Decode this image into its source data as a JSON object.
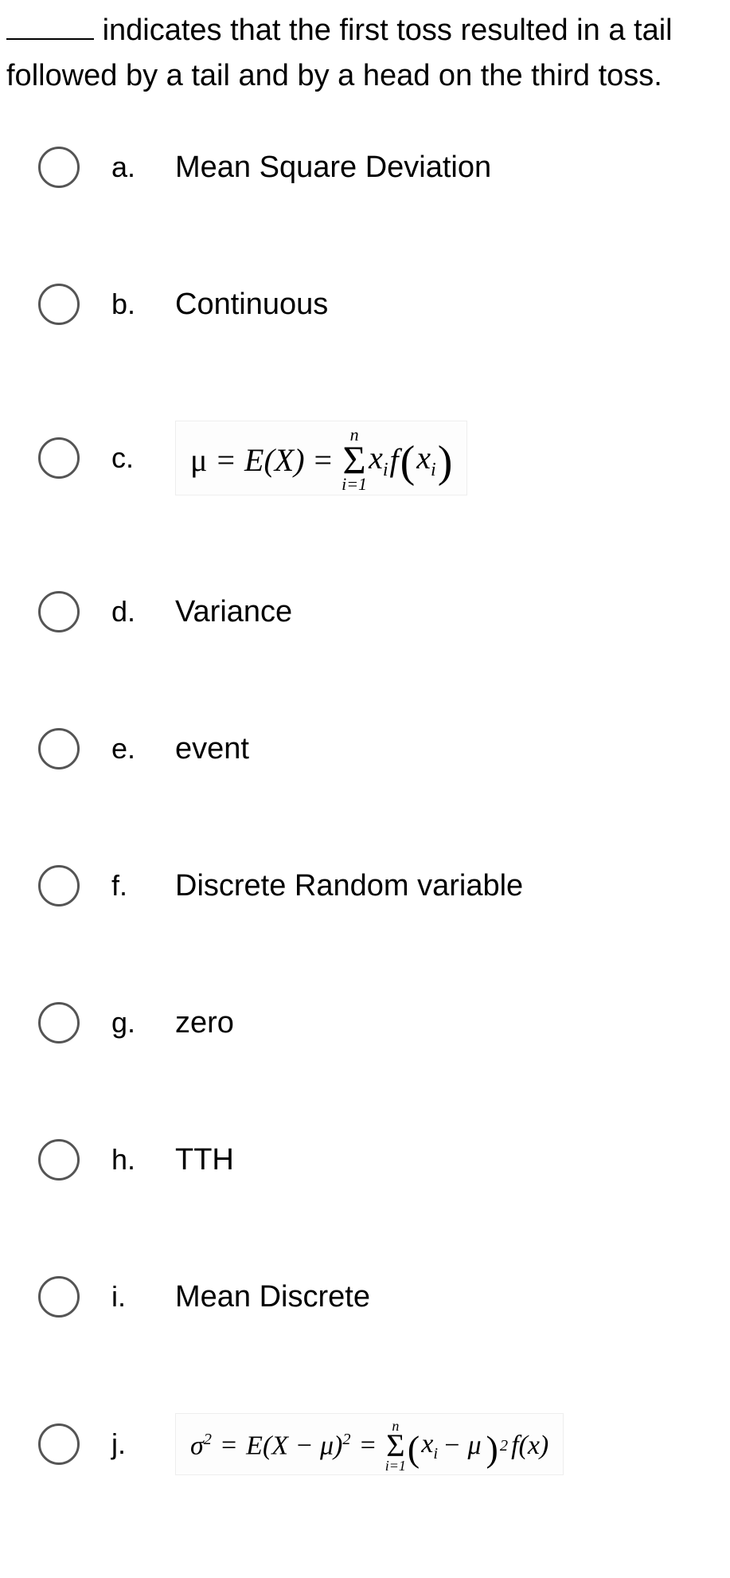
{
  "question": {
    "text_after_blank": "indicates that the first toss resulted in a tail followed by a tail and by a head on the third toss."
  },
  "options": {
    "a": {
      "letter": "a.",
      "text": "Mean Square Deviation"
    },
    "b": {
      "letter": "b.",
      "text": "Continuous"
    },
    "c": {
      "letter": "c."
    },
    "d": {
      "letter": "d.",
      "text": "Variance"
    },
    "e": {
      "letter": "e.",
      "text": "event"
    },
    "f": {
      "letter": "f.",
      "text": "Discrete Random variable"
    },
    "g": {
      "letter": "g.",
      "text": "zero"
    },
    "h": {
      "letter": "h.",
      "text": "TTH"
    },
    "i": {
      "letter": "i.",
      "text": "Mean Discrete"
    },
    "j": {
      "letter": "j."
    }
  },
  "formulas": {
    "c": {
      "mu": "μ",
      "eq1": "=",
      "ex": "E(X)",
      "eq2": "=",
      "sum_top": "n",
      "sum_bot": "i=1",
      "xi": "x",
      "xi_sub": "i",
      "f": "f",
      "lparen": "(",
      "x2": "x",
      "x2_sub": "i",
      "rparen": ")"
    },
    "j": {
      "sigma": "σ",
      "sq1": "2",
      "eq1": "=",
      "ex": "E(X − μ)",
      "sq2": "2",
      "eq2": "=",
      "sum_top": "n",
      "sum_bot": "i=1",
      "lparen": "(",
      "xi": "x",
      "xi_sub": "i",
      "minus": "− μ",
      "rparen": ")",
      "sq3": "2",
      "f": "f(x)"
    }
  }
}
